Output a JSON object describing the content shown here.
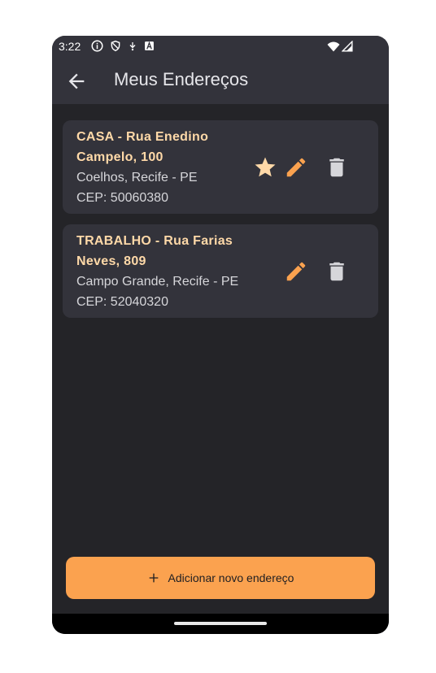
{
  "status_bar": {
    "time": "3:22",
    "icons": [
      "info-circle-icon",
      "shield-icon",
      "download-icon",
      "a-box-icon",
      "wifi-icon",
      "cell-signal-icon"
    ]
  },
  "app_bar": {
    "title": "Meus Endereços",
    "back_icon": "arrow-left-icon"
  },
  "addresses": [
    {
      "title_line1": "CASA - Rua Enedino",
      "title_line2": "Campelo, 100",
      "neighborhood": "Coelhos, Recife - PE",
      "cep": "CEP: 50060380",
      "is_default": true
    },
    {
      "title_line1": "TRABALHO - Rua Farias",
      "title_line2": "Neves, 809",
      "neighborhood": "Campo Grande, Recife - PE",
      "cep": "CEP: 52040320",
      "is_default": false
    }
  ],
  "add_button": {
    "label": "Adicionar novo endereço",
    "icon": "plus-icon"
  },
  "colors": {
    "accent": "#fba24f",
    "title_text": "#ffd9a8",
    "background": "#242428",
    "surface": "#33333b"
  }
}
